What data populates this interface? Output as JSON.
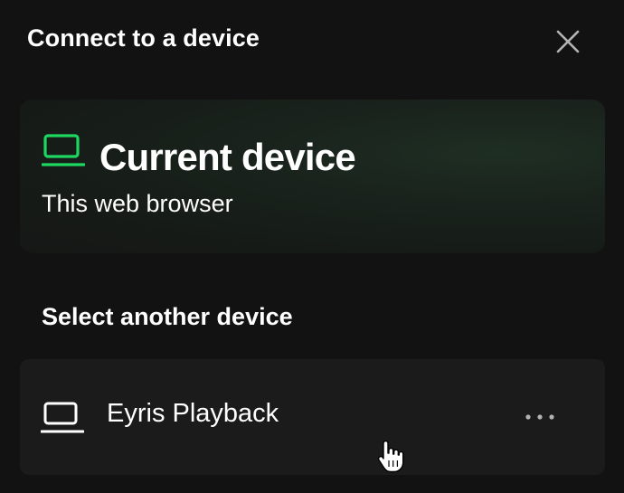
{
  "header": {
    "title": "Connect to a device",
    "close_icon": "close-icon"
  },
  "current_device": {
    "title": "Current device",
    "subtitle": "This web browser",
    "icon": "laptop-icon",
    "accent_color": "#1ed760"
  },
  "other_devices": {
    "heading": "Select another device",
    "items": [
      {
        "label": "Eyris Playback",
        "icon": "laptop-icon",
        "more_icon": "more-options-icon"
      }
    ]
  },
  "colors": {
    "background": "#121212",
    "text": "#ffffff",
    "row_background": "#1b1b1b",
    "muted_icon": "#b3b3b3"
  }
}
